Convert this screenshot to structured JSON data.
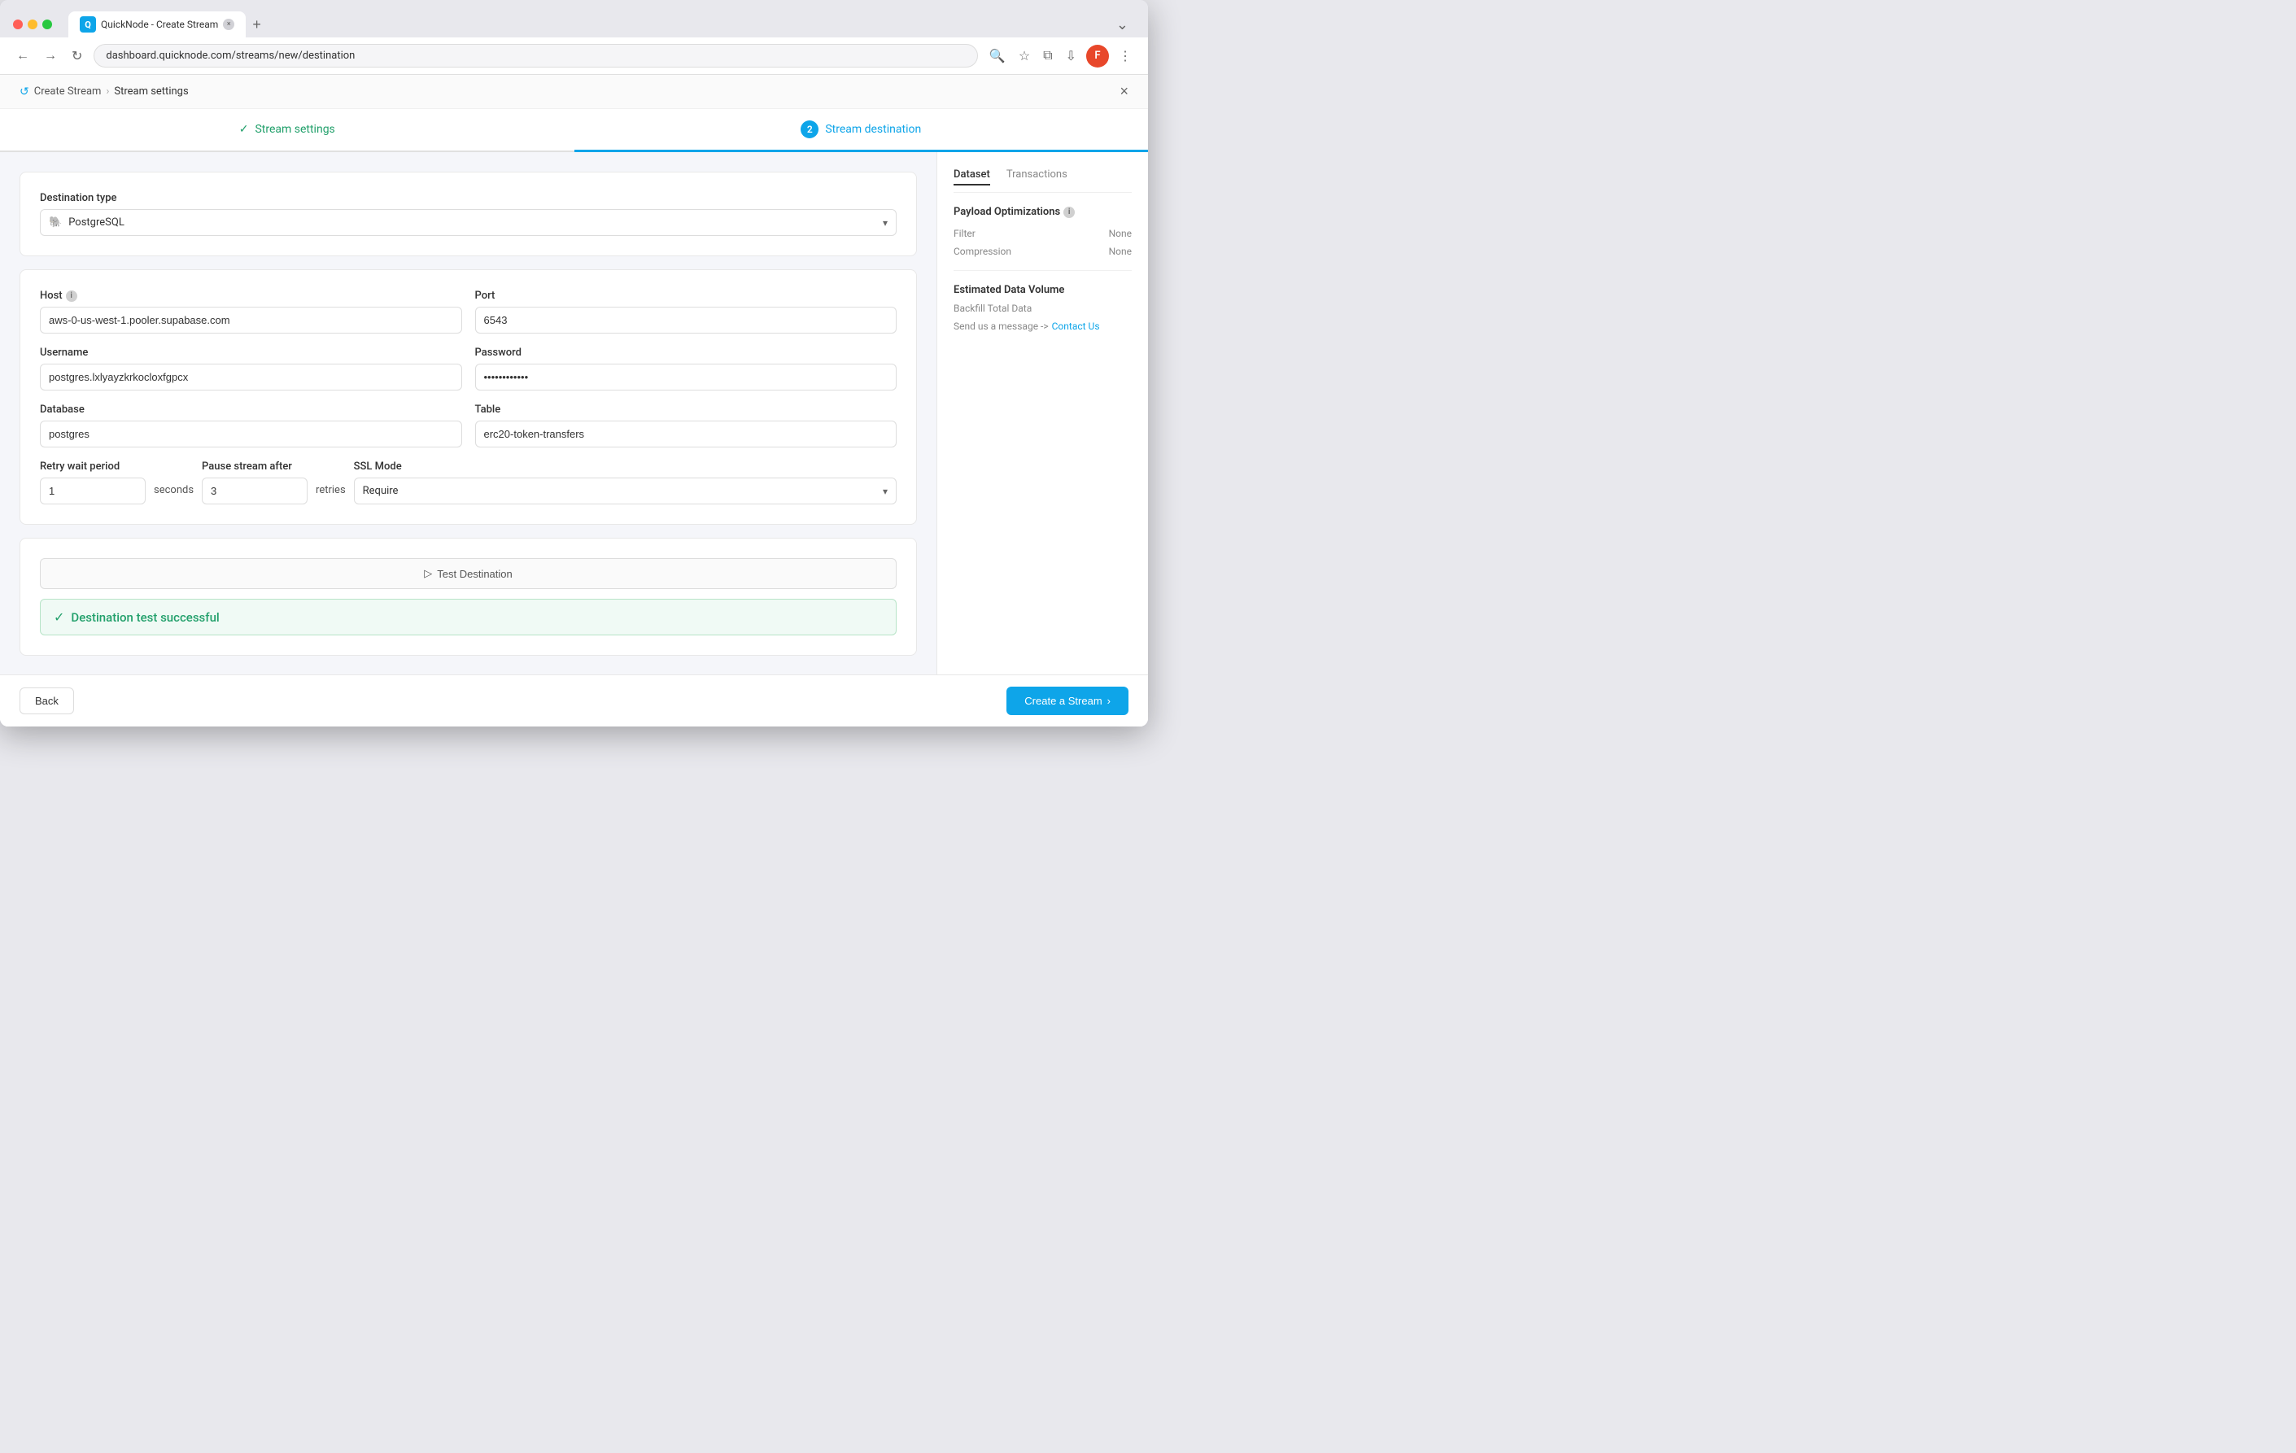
{
  "browser": {
    "url": "dashboard.quicknode.com/streams/new/destination",
    "tab_title": "QuickNode - Create Stream",
    "user_initial": "F"
  },
  "breadcrumb": {
    "parent": "Create Stream",
    "current": "Stream settings",
    "close_label": "×"
  },
  "steps": [
    {
      "id": "stream-settings",
      "number": "",
      "label": "Stream settings",
      "state": "completed"
    },
    {
      "id": "stream-destination",
      "number": "2",
      "label": "Stream destination",
      "state": "active"
    }
  ],
  "form": {
    "destination_type": {
      "label": "Destination type",
      "value": "PostgreSQL",
      "icon": "🐘"
    },
    "host": {
      "label": "Host",
      "value": "aws-0-us-west-1.pooler.supabase.com"
    },
    "port": {
      "label": "Port",
      "value": "6543"
    },
    "username": {
      "label": "Username",
      "value": "postgres.lxlyayzkrkocloxfgpcx"
    },
    "password": {
      "label": "Password",
      "value": "············"
    },
    "database": {
      "label": "Database",
      "value": "postgres"
    },
    "table": {
      "label": "Table",
      "value": "erc20-token-transfers"
    },
    "retry_wait_period": {
      "label": "Retry wait period",
      "value": "1",
      "suffix": "seconds"
    },
    "pause_stream_after": {
      "label": "Pause stream after",
      "value": "3",
      "suffix": "retries"
    },
    "ssl_mode": {
      "label": "SSL Mode",
      "value": "Require"
    },
    "test_button_label": "▷  Test Destination",
    "success_message": "Destination test successful"
  },
  "sidebar": {
    "tabs": [
      "Dataset",
      "Transactions"
    ],
    "active_tab": "Dataset",
    "payload_optimizations": {
      "title": "Payload Optimizations",
      "filter_label": "Filter",
      "filter_value": "None",
      "compression_label": "Compression",
      "compression_value": "None"
    },
    "estimated_data_volume": {
      "title": "Estimated Data Volume",
      "backfill_label": "Backfill Total Data",
      "send_message_text": "Send us a message ->",
      "contact_us_label": "Contact Us"
    }
  },
  "footer": {
    "back_label": "Back",
    "create_label": "Create a Stream",
    "create_arrow": "›"
  }
}
